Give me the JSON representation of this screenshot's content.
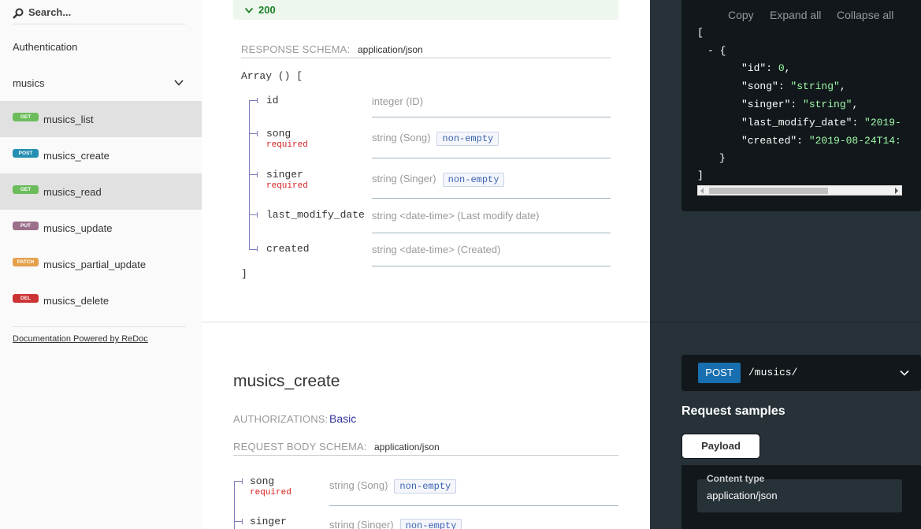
{
  "sidebar": {
    "search_placeholder": "Search...",
    "items": [
      {
        "label": "Authentication"
      },
      {
        "label": "musics"
      },
      {
        "method": "GET",
        "label": "musics_list",
        "color": "#6bbd5b"
      },
      {
        "method": "POST",
        "label": "musics_create",
        "color": "#248fb2"
      },
      {
        "method": "GET",
        "label": "musics_read",
        "color": "#6bbd5b"
      },
      {
        "method": "PUT",
        "label": "musics_update",
        "color": "#9b708b"
      },
      {
        "method": "PATCH",
        "label": "musics_partial_update",
        "color": "#e5a04a"
      },
      {
        "method": "DEL",
        "label": "musics_delete",
        "color": "#cc3333"
      }
    ],
    "powered_by": "Documentation Powered by ReDoc"
  },
  "response": {
    "status": "200",
    "schema_label": "RESPONSE SCHEMA:",
    "content_type": "application/json",
    "array_open": "Array () [",
    "array_close": "]",
    "props": [
      {
        "name": "id",
        "required": "",
        "type": "integer (ID)",
        "tag": ""
      },
      {
        "name": "song",
        "required": "required",
        "type": "string (Song)",
        "tag": "non-empty"
      },
      {
        "name": "singer",
        "required": "required",
        "type": "string (Singer)",
        "tag": "non-empty"
      },
      {
        "name": "last_modify_date",
        "required": "",
        "type": "string <date-time> (Last modify date)",
        "tag": ""
      },
      {
        "name": "created",
        "required": "",
        "type": "string <date-time> (Created)",
        "tag": ""
      }
    ]
  },
  "create": {
    "title": "musics_create",
    "auth_label": "AUTHORIZATIONS:",
    "auth_value": "Basic",
    "body_label": "REQUEST BODY SCHEMA:",
    "content_type": "application/json",
    "props": [
      {
        "name": "song",
        "required": "required",
        "type": "string (Song)",
        "tag": "non-empty"
      },
      {
        "name": "singer",
        "required": "",
        "type": "string (Singer)",
        "tag": "non-empty"
      }
    ]
  },
  "json_panel": {
    "copy": "Copy",
    "expand": "Expand all",
    "collapse": "Collapse all",
    "lines": {
      "open": "[",
      "obj_open": "- {",
      "id_key": "\"id\"",
      "id_val": "0",
      "song_key": "\"song\"",
      "song_val": "\"string\"",
      "singer_key": "\"singer\"",
      "singer_val": "\"string\"",
      "lmd_key": "\"last_modify_date\"",
      "lmd_val": "\"2019-",
      "created_key": "\"created\"",
      "created_val": "\"2019-08-24T14:",
      "obj_close": "}",
      "close": "]"
    }
  },
  "endpoint": {
    "method": "POST",
    "path": "/musics/",
    "request_samples": "Request samples",
    "payload_tab": "Payload",
    "content_type_label": "Content type",
    "content_type_value": "application/json"
  }
}
